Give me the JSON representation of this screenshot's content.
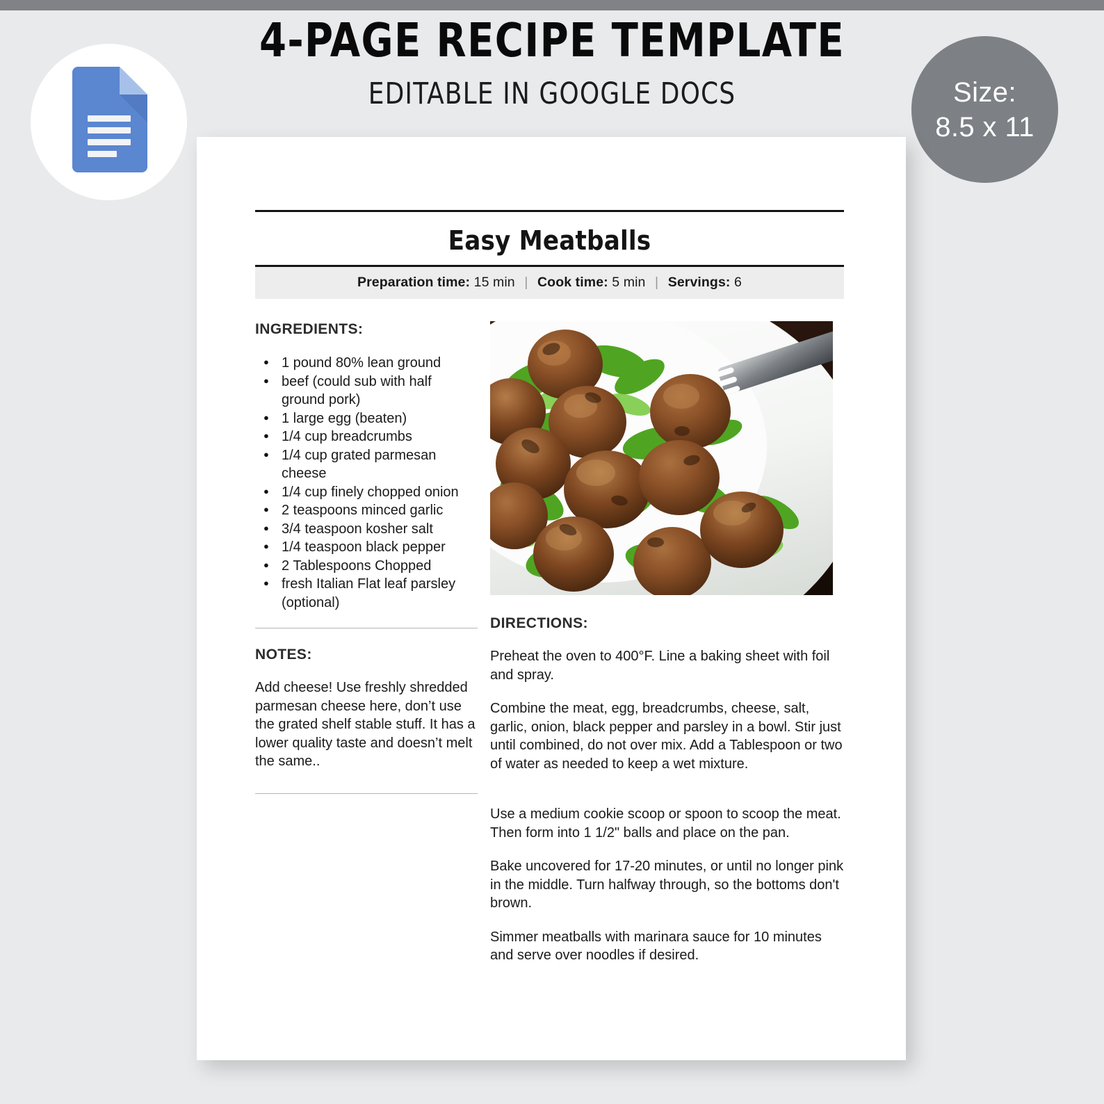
{
  "promo": {
    "title": "4-PAGE RECIPE TEMPLATE",
    "subtitle": "EDITABLE IN GOOGLE DOCS",
    "docs_badge_icon": "google-docs-icon",
    "size_label": "Size:",
    "size_value": "8.5 x 11"
  },
  "colors": {
    "page_background": "#e9eaec",
    "top_bar": "#808286",
    "size_badge": "#7d8084",
    "docs_icon_blue": "#5b86d0",
    "docs_icon_fold": "#a7c0ea",
    "meta_bar": "#ededed",
    "rule_dark": "#141414",
    "rule_light": "#b6b6b6"
  },
  "document": {
    "title": "Easy Meatballs",
    "meta": {
      "prep_label": "Preparation time:",
      "prep_value": "15 min",
      "cook_label": "Cook time:",
      "cook_value": "5 min",
      "servings_label": "Servings:",
      "servings_value": "6",
      "separator": "|"
    },
    "ingredients_heading": "INGREDIENTS:",
    "ingredients": [
      "1 pound 80% lean ground",
      "beef (could sub with half ground pork)",
      "1 large egg (beaten)",
      "1/4 cup breadcrumbs",
      "1/4 cup grated parmesan cheese",
      "1/4 cup finely chopped onion",
      "2 teaspoons minced garlic",
      "3/4 teaspoon kosher salt",
      "1/4 teaspoon black pepper",
      "2 Tablespoons Chopped",
      "fresh Italian Flat leaf parsley (optional)"
    ],
    "notes_heading": "NOTES:",
    "notes_body": "Add cheese! Use freshly shredded parmesan cheese here, don’t use the grated shelf stable stuff. It has a lower quality taste and doesn’t melt the same..",
    "directions_heading": "DIRECTIONS:",
    "directions": [
      "Preheat the oven to 400°F. Line a baking sheet with foil and spray.",
      "Combine the meat, egg, breadcrumbs, cheese, salt, garlic, onion, black pepper and parsley in a bowl. Stir just until combined, do not over mix. Add a Tablespoon or two of water as needed to keep a wet mixture.",
      "Use a medium cookie scoop or spoon to scoop the meat. Then form into 1 1/2\" balls and place on the pan.",
      "Bake uncovered for 17-20 minutes, or until no longer pink in the middle. Turn halfway through, so the bottoms don't brown.",
      "Simmer meatballs with marinara sauce for 10 minutes and serve over noodles if desired."
    ],
    "photo_alt": "meatballs-photo"
  }
}
